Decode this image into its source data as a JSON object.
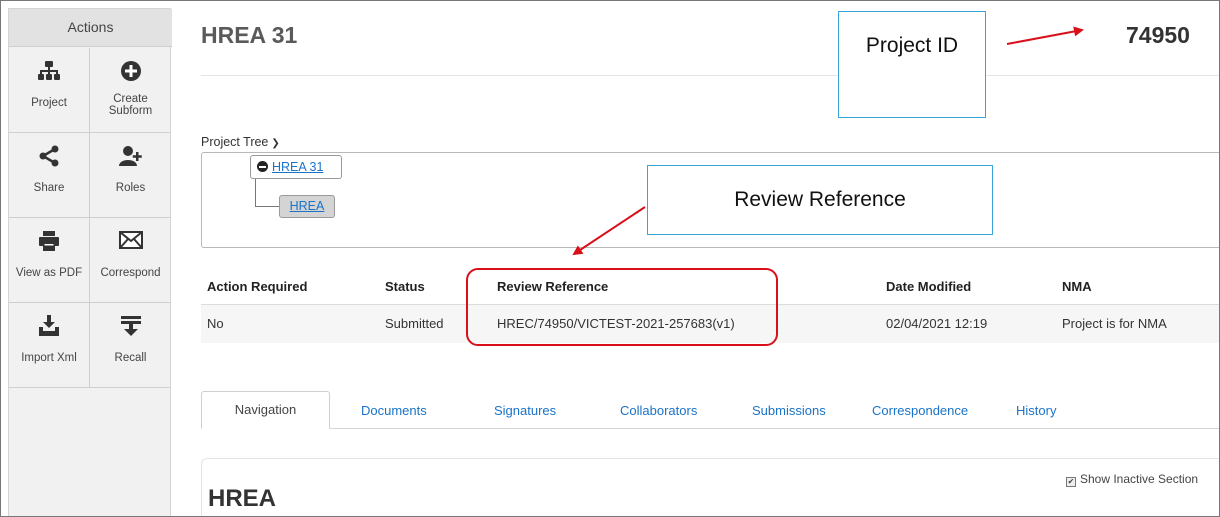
{
  "sidebar": {
    "title": "Actions",
    "actions": [
      {
        "label": "Project",
        "icon": "sitemap-icon"
      },
      {
        "label": "Create Subform",
        "icon": "plus-circle-icon"
      },
      {
        "label": "Share",
        "icon": "share-icon"
      },
      {
        "label": "Roles",
        "icon": "user-plus-icon"
      },
      {
        "label": "View as PDF",
        "icon": "printer-icon"
      },
      {
        "label": "Correspond",
        "icon": "envelope-icon"
      },
      {
        "label": "Import Xml",
        "icon": "import-icon"
      },
      {
        "label": "Recall",
        "icon": "recall-icon"
      }
    ]
  },
  "header": {
    "title": "HREA 31",
    "project_id": "74950"
  },
  "annotations": {
    "project_id_callout": "Project ID",
    "review_reference_callout": "Review Reference",
    "arrow_color": "#d8101a",
    "callout_border_color": "#3aa3d8"
  },
  "tree": {
    "label": "Project Tree",
    "root": "HREA 31",
    "child": "HREA"
  },
  "table": {
    "headers": [
      "Action Required",
      "Status",
      "Review Reference",
      "Date Modified",
      "NMA"
    ],
    "row": [
      "No",
      "Submitted",
      "HREC/74950/VICTEST-2021-257683(v1)",
      "02/04/2021 12:19",
      "Project is for NMA"
    ]
  },
  "tabs": [
    "Navigation",
    "Documents",
    "Signatures",
    "Collaborators",
    "Submissions",
    "Correspondence",
    "History"
  ],
  "content": {
    "title": "HREA",
    "show_inactive_label": "Show Inactive Section"
  },
  "colors": {
    "link": "#1a73c7",
    "highlight_border": "#d8101a"
  }
}
